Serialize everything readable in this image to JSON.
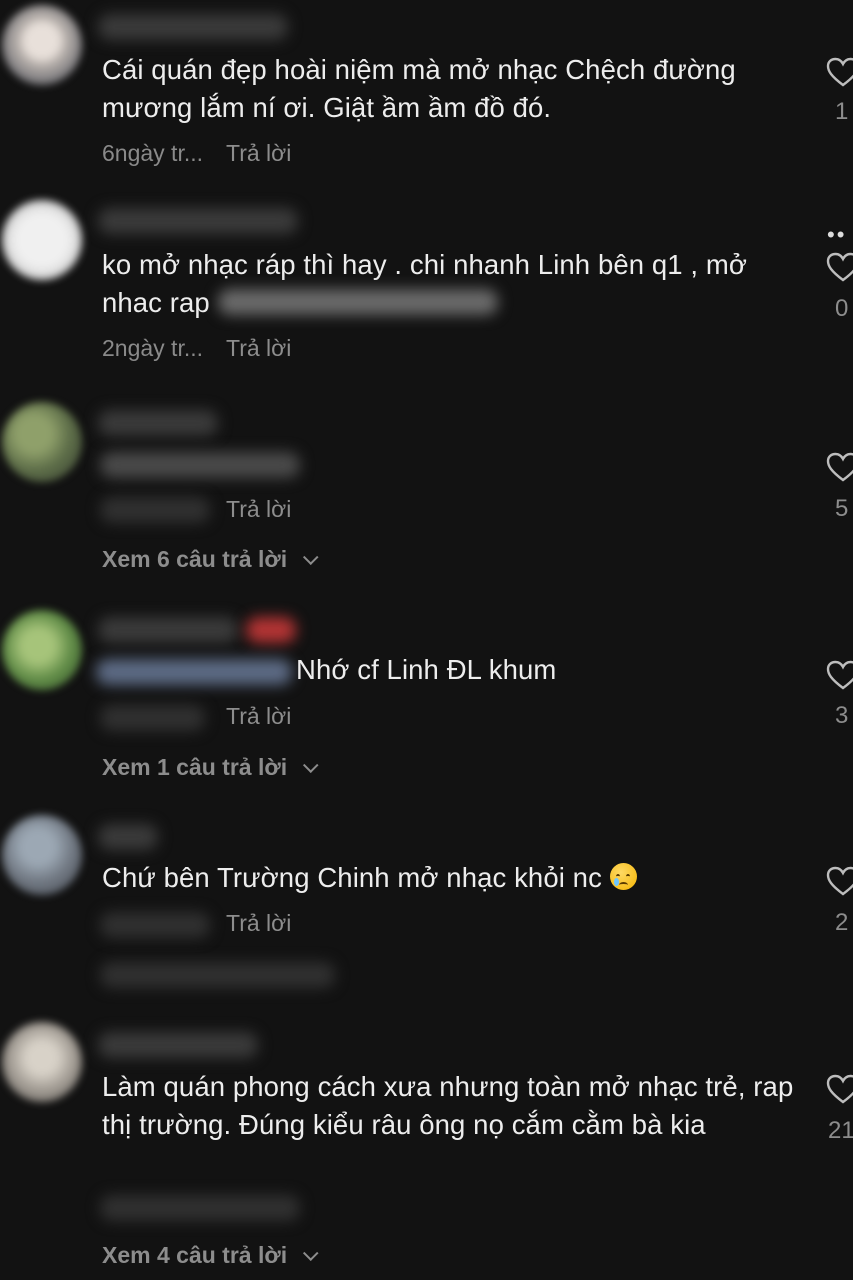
{
  "comments": [
    {
      "text": "Cái quán đẹp hoài niệm mà mở nhạc Chệch đường mương lắm ní ơi. Giật ầm ầm đồ đó.",
      "meta": "6ngày tr...",
      "reply_label": "Trả lời",
      "likes": "1"
    },
    {
      "text": "ko mở nhạc ráp thì hay . chi nhanh Linh bên q1 , mở nhac rap",
      "meta": "2ngày tr...",
      "reply_label": "Trả lời",
      "likes": "0"
    },
    {
      "reply_label": "Trả lời",
      "likes": "5",
      "view_replies": "Xem 6 câu trả lời"
    },
    {
      "text": "Nhớ cf Linh ĐL khum",
      "reply_label": "Trả lời",
      "likes": "3",
      "view_replies": "Xem 1 câu trả lời"
    },
    {
      "text": "Chứ bên Trường Chinh mở nhạc khỏi nc",
      "reply_label": "Trả lời",
      "likes": "2"
    },
    {
      "text": "Làm quán phong cách xưa nhưng toàn mở nhạc trẻ, rap thị trường. Đúng kiểu râu ông nọ cắm cằm bà kia",
      "likes": "21",
      "view_replies": "Xem 4 câu trả lời"
    }
  ],
  "icons": {
    "like": "heart-outline-icon",
    "more": "more-dots-icon",
    "expand": "chevron-down-icon",
    "emoji": "crying-face-emoji"
  },
  "colors": {
    "background": "#121212",
    "text": "#ededed",
    "muted": "#8d8d8d"
  }
}
